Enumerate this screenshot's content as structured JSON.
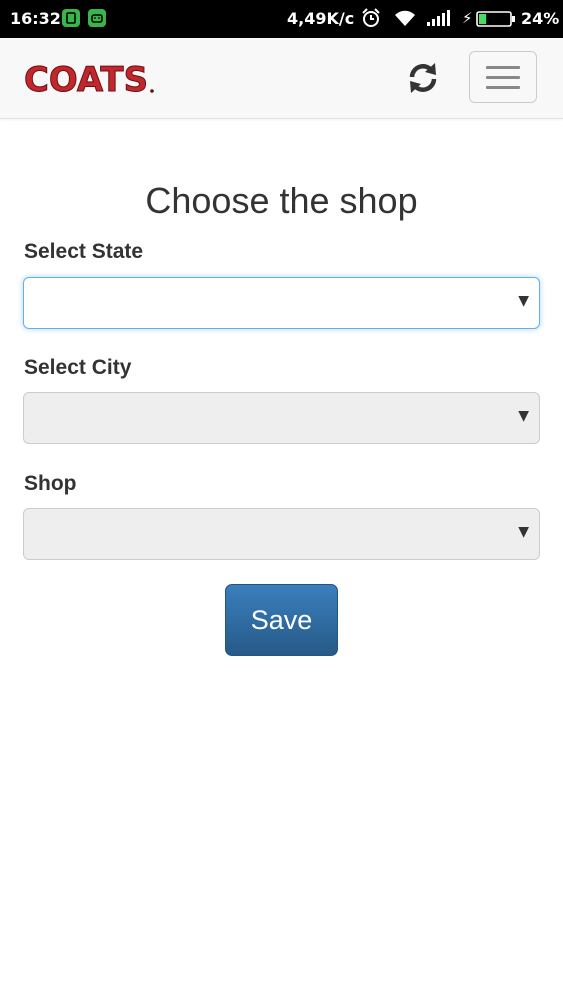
{
  "status_bar": {
    "time": "16:32",
    "speed": "4,49K/c",
    "battery_percent": "24%",
    "battery_level": 0.24,
    "icons": [
      "notification-app-icon",
      "android-app-icon",
      "alarm-icon",
      "wifi-icon",
      "signal-icon",
      "charging-icon",
      "battery-icon"
    ]
  },
  "navbar": {
    "logo_text": "COATS",
    "refresh_icon": "refresh-icon",
    "menu_icon": "hamburger-menu-icon"
  },
  "page": {
    "title": "Choose the shop"
  },
  "form": {
    "state_label": "Select State",
    "state_value": "",
    "city_label": "Select City",
    "city_value": "",
    "shop_label": "Shop",
    "shop_value": "",
    "caret": "▼",
    "save_label": "Save"
  },
  "colors": {
    "brand_red": "#c1272d",
    "primary_button": "#2e6da4",
    "focus_border": "#66afe9"
  }
}
